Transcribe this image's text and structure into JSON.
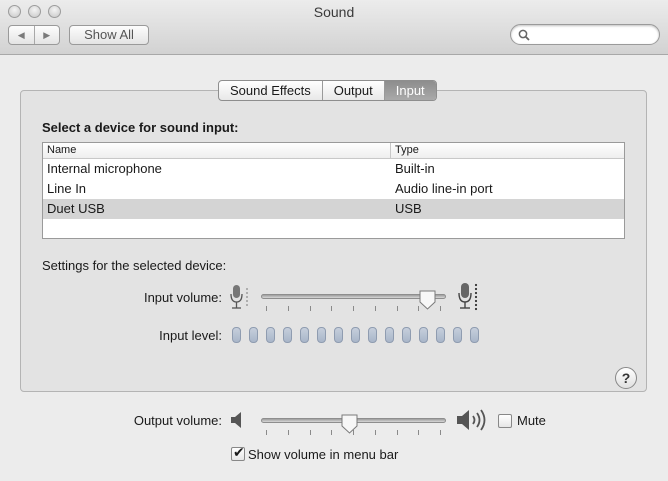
{
  "window": {
    "title": "Sound"
  },
  "toolbar": {
    "back_icon": "back-arrow-icon",
    "forward_icon": "forward-arrow-icon",
    "show_all_label": "Show All",
    "search_value": "",
    "search_placeholder": ""
  },
  "tabs": [
    {
      "label": "Sound Effects",
      "active": false
    },
    {
      "label": "Output",
      "active": false
    },
    {
      "label": "Input",
      "active": true
    }
  ],
  "input_panel": {
    "section_title": "Select a device for sound input:",
    "columns": [
      "Name",
      "Type"
    ],
    "devices": [
      {
        "name": "Internal microphone",
        "type": "Built-in",
        "selected": false
      },
      {
        "name": "Line In",
        "type": "Audio line-in port",
        "selected": false
      },
      {
        "name": "Duet USB",
        "type": "USB",
        "selected": true
      }
    ],
    "settings_label": "Settings for the selected device:",
    "input_volume_label": "Input volume:",
    "input_volume_level": 0.9,
    "input_level_label": "Input level:",
    "input_level_segments": 15,
    "input_level_value": 0
  },
  "output": {
    "output_volume_label": "Output volume:",
    "output_volume_level": 0.48,
    "mute_label": "Mute",
    "mute_checked": false,
    "show_volume_label": "Show volume in menu bar",
    "show_volume_checked": true
  },
  "help_label": "?"
}
